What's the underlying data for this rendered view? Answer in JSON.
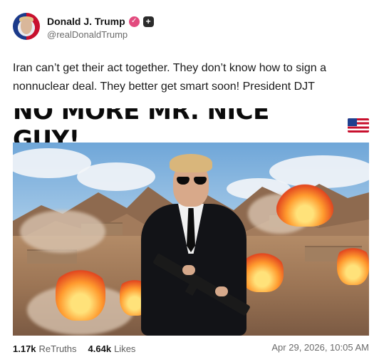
{
  "author": {
    "name": "Donald J. Trump",
    "handle": "@realDonaldTrump",
    "verified_icon": "verified-badge-icon",
    "extra_icon": "plus-icon"
  },
  "post": {
    "text": "Iran can’t get their act together. They don’t know how to sign a nonnuclear deal. They better get smart soon! President DJT",
    "media_caption": "NO MORE MR. NICE GUY!",
    "media_emoji": "US flag"
  },
  "footer": {
    "retruths_count": "1.17k",
    "retruths_label": "ReTruths",
    "likes_count": "4.64k",
    "likes_label": "Likes",
    "timestamp": "Apr 29, 2026, 10:05 AM"
  },
  "colors": {
    "verified": "#e24b7e",
    "text_primary": "#111111",
    "text_secondary": "#6b6b6b"
  }
}
